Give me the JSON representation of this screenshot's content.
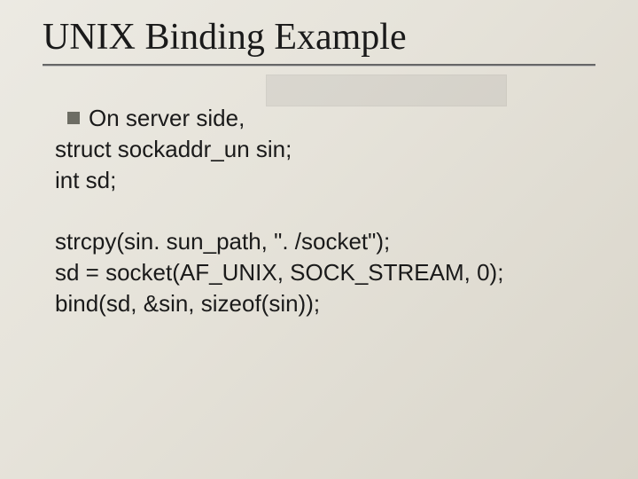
{
  "slide": {
    "title": "UNIX Binding Example",
    "bullet": "On server side,",
    "lines": {
      "l1": "struct sockaddr_un sin;",
      "l2": "int sd;",
      "l3": "strcpy(sin. sun_path, \". /socket\");",
      "l4": "sd = socket(AF_UNIX, SOCK_STREAM, 0);",
      "l5": "bind(sd, &sin, sizeof(sin));"
    }
  }
}
